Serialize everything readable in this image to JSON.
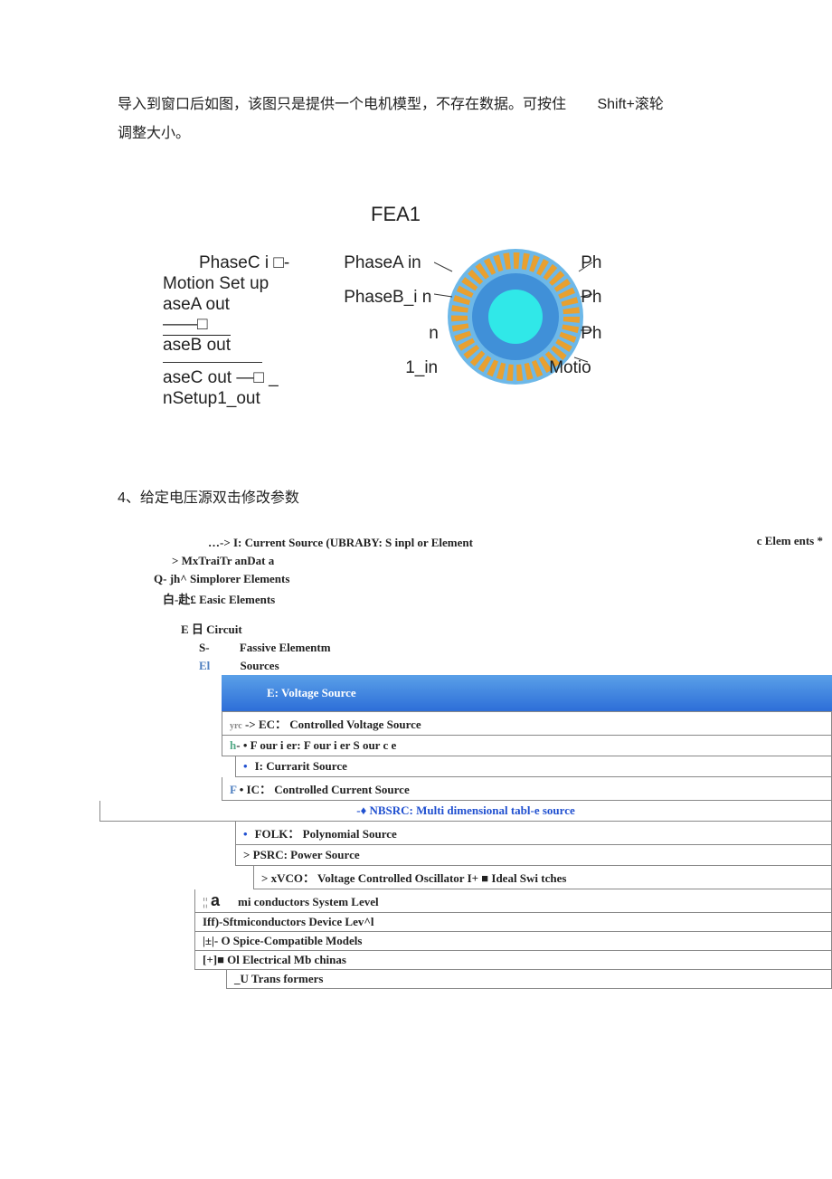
{
  "intro": {
    "line1_a": "导入到窗口后如图，该图只是提供一个电机模型，不存在数据。可按住",
    "line1_b": "Shift+滚轮",
    "line2": "调整大小。"
  },
  "fea": {
    "title": "FEA1",
    "left": {
      "l1": "PhaseC i □-",
      "l2": "Motion Set up",
      "l3": "aseA out",
      "l4": "——□",
      "l5": "aseB out",
      "l6": "aseC out —□ _",
      "l7": "nSetup1_out"
    },
    "right": {
      "phaseA": "PhaseA in",
      "phaseB": "PhaseB_i n",
      "n": "n",
      "one": "1_in",
      "ph1": "Ph",
      "ph2": "Ph",
      "ph3": "Ph",
      "motio": "Motio"
    }
  },
  "section4": "4、给定电压源双击修改参数",
  "tree": {
    "top_right": "c Elem ents *",
    "line1": "…-> I: Current Source (UBRABY: S inpl or Element",
    "line2": "> MxTraiTr anDat a",
    "line3": "Q- jh^ Simplorer Elements",
    "line4": "白-赴£ Easic Elements",
    "line5": "E 日  Circuit",
    "line6a": "S-",
    "line6b": "Fassive Elementm",
    "line7a": "El",
    "line7b": "Sources",
    "sources": {
      "voltage": "E: Voltage Source",
      "ec": "-> EC：  Controlled Voltage Source",
      "fourier": "- • F our i er: F our i er S our c e",
      "icurr": "I: Currarit Source",
      "ic": " • IC：  Controlled Current Source",
      "nbsrc": "-♦ NBSRC: Multi dimensional tabl-e source",
      "folk": "FOLK：  Polynomial Source",
      "psrc": ">  PSRC: Power Source",
      "xvco": ">  xVCO：  Voltage Controlled Oscillator I+ ■ Ideal Swi tches"
    },
    "bottom": {
      "semi_sys": "mi conductors System Level",
      "semi_dev": "Iff)-Sftmiconductors Device Lev^l",
      "spice": "|±|- O Spice-Compatible Models",
      "elec": "[+]■ Ol Electrical Mb chinas",
      "trans": "_U Trans formers"
    }
  }
}
